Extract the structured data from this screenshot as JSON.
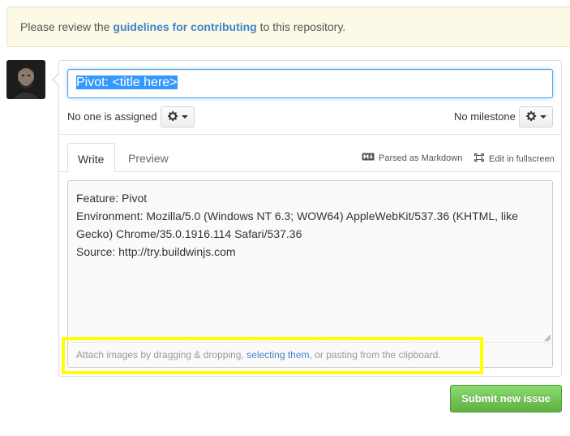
{
  "flash": {
    "prefix": "Please review the ",
    "link": "guidelines for contributing",
    "suffix": " to this repository."
  },
  "issue_form": {
    "title_value": "Pivot: <title here>",
    "assignee_text": "No one is assigned",
    "milestone_text": "No milestone",
    "tabs": [
      {
        "label": "Write",
        "active": true
      },
      {
        "label": "Preview",
        "active": false
      }
    ],
    "markdown_label": "Parsed as Markdown",
    "fullscreen_label": "Edit in fullscreen",
    "body_lines": [
      "Feature: Pivot",
      "Environment: Mozilla/5.0 (Windows NT 6.3; WOW64) AppleWebKit/537.36 (KHTML, like",
      "Gecko) Chrome/35.0.1916.114 Safari/537.36",
      "Source: http://try.buildwinjs.com"
    ],
    "attach": {
      "prefix": "Attach images by dragging & dropping, ",
      "link": "selecting them",
      "suffix": ", or pasting from the clipboard."
    },
    "submit_label": "Submit new issue"
  },
  "icons": {
    "gear": "gear-icon",
    "markdown": "markdown-icon",
    "fullscreen": "fullscreen-icon"
  },
  "colors": {
    "link": "#4183c4",
    "submit": "#60b044",
    "highlight": "#ffff00",
    "focus": "#51a7e8"
  }
}
